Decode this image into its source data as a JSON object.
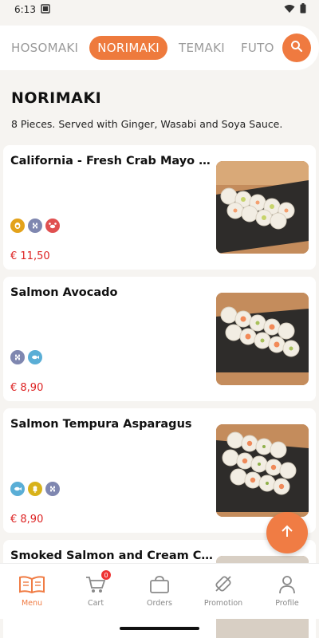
{
  "status_bar": {
    "time": "6:13"
  },
  "tabs": [
    {
      "label": "HOSOMAKI",
      "active": false
    },
    {
      "label": "NORIMAKI",
      "active": true
    },
    {
      "label": "TEMAKI",
      "active": false
    },
    {
      "label": "FUTO",
      "active": false
    }
  ],
  "accent_color": "#ef7a40",
  "section": {
    "title": "NORIMAKI",
    "description": "8 Pieces. Served with Ginger, Wasabi and Soya Sauce."
  },
  "products": [
    {
      "name": "California - Fresh Crab Mayo and Av...",
      "price": "€ 11,50",
      "icons": [
        "egg-icon",
        "sesame-icon",
        "crab-icon"
      ]
    },
    {
      "name": "Salmon Avocado",
      "price": "€ 8,90",
      "icons": [
        "sesame-icon",
        "fish-icon"
      ]
    },
    {
      "name": "Salmon Tempura Asparagus",
      "price": "€ 8,90",
      "icons": [
        "fish-icon",
        "gluten-icon",
        "sesame-icon"
      ]
    },
    {
      "name": "Smoked Salmon and Cream Cheese",
      "price": "",
      "icons": []
    }
  ],
  "bottom_nav": [
    {
      "label": "Menu",
      "icon": "menu-book-icon",
      "active": true
    },
    {
      "label": "Cart",
      "icon": "cart-icon",
      "active": false,
      "badge": "0"
    },
    {
      "label": "Orders",
      "icon": "bag-icon",
      "active": false
    },
    {
      "label": "Promotion",
      "icon": "tag-icon",
      "active": false
    },
    {
      "label": "Profile",
      "icon": "user-icon",
      "active": false
    }
  ]
}
